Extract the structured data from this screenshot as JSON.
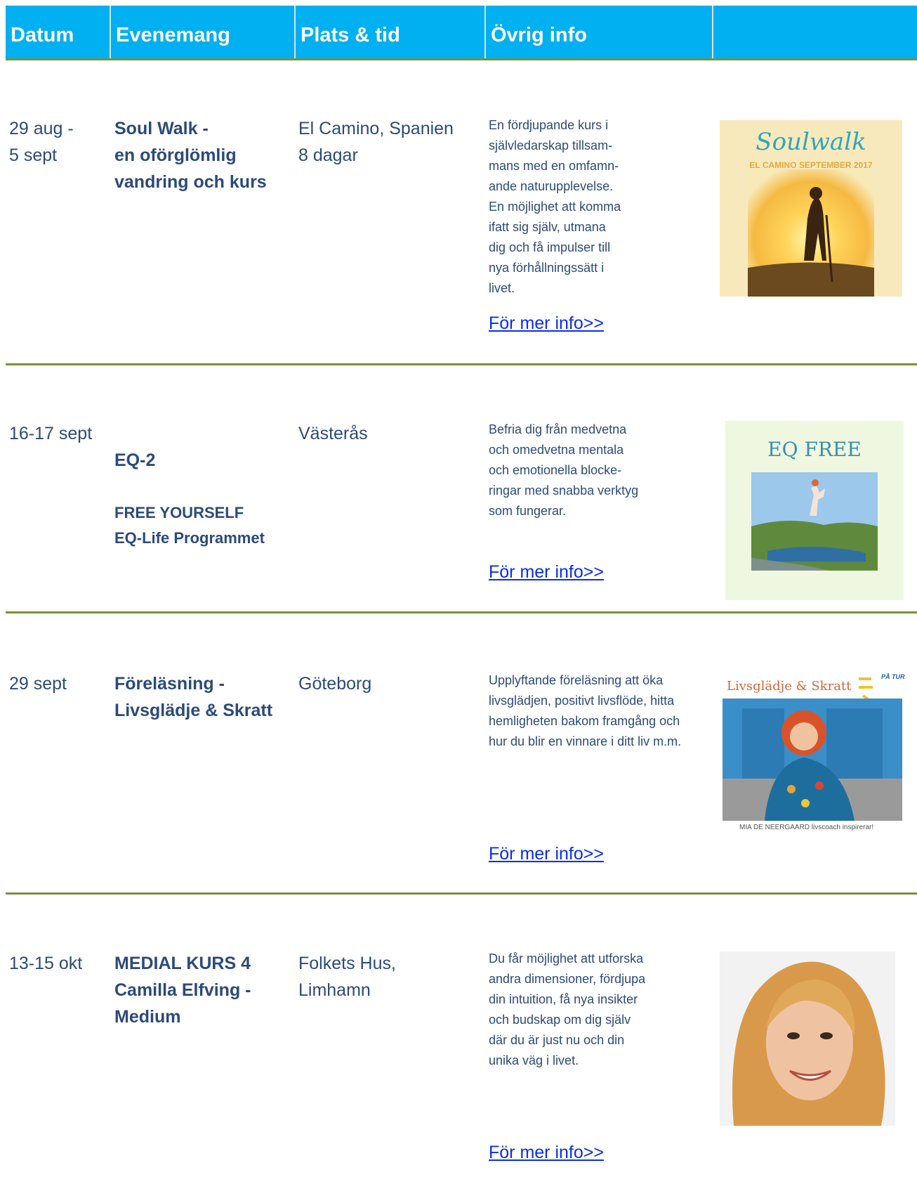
{
  "header": {
    "col_date": "Datum",
    "col_event": "Evenemang",
    "col_place": "Plats & tid",
    "col_info": "Övrig info",
    "col_image": ""
  },
  "events": [
    {
      "date": "29 aug -\n5 sept",
      "title": "Soul Walk -\nen oförglömlig\nvandring och kurs",
      "place": "El Camino, Spanien\n8 dagar",
      "info": "En fördjupande kurs i\nsjälvledarskap  tillsam-\nmans med en omfamn-\nande naturupplevelse.\nEn möjlighet att komma\nifatt sig själv, utmana\ndig och få impulser till\nnya förhållningssätt i\nlivet.",
      "link": "För mer info>>",
      "image": {
        "title": "Soulwalk",
        "subtitle": "EL CAMINO SEPTEMBER 2017"
      }
    },
    {
      "date": "16-17 sept",
      "title_main": "EQ-2",
      "title_sub": "FREE YOURSELF\nEQ-Life Programmet",
      "place": "Västerås",
      "info": "Befria dig från medvetna\noch omedvetna mentala\noch emotionella blocke-\nringar med snabba verktyg\nsom fungerar.",
      "link": "För mer info>>",
      "image": {
        "title": "EQ FREE"
      }
    },
    {
      "date": "29 sept",
      "title": "Föreläsning -\nLivsglädje & Skratt",
      "place": "Göteborg",
      "info": "Upplyftande föreläsning att öka\nlivsglädjen, positivt livsflöde, hitta\nhemligheten bakom framgång och\nhur du blir en vinnare i ditt liv m.m.",
      "link": "För mer info>>",
      "image": {
        "title": "Livsglädje & Skratt",
        "badge": "PÅ TURNÉ",
        "caption": "MIA DE NEERGAARD livscoach inspirerar!"
      }
    },
    {
      "date": "13-15 okt",
      "title": "MEDIAL KURS 4\nCamilla Elfving -\nMedium",
      "place": "Folkets Hus,\nLimhamn",
      "info": "Du får möjlighet att utforska\nandra dimensioner, fördjupa\ndin intuition, få nya insikter\noch budskap om dig själv\ndär du är just nu och din\nunika väg i livet.",
      "link": "För mer info>>"
    }
  ],
  "colors": {
    "header_bg": "#00b0f0",
    "rule": "#77933c",
    "text": "#2c4a7a",
    "link": "#0a2cf0"
  }
}
